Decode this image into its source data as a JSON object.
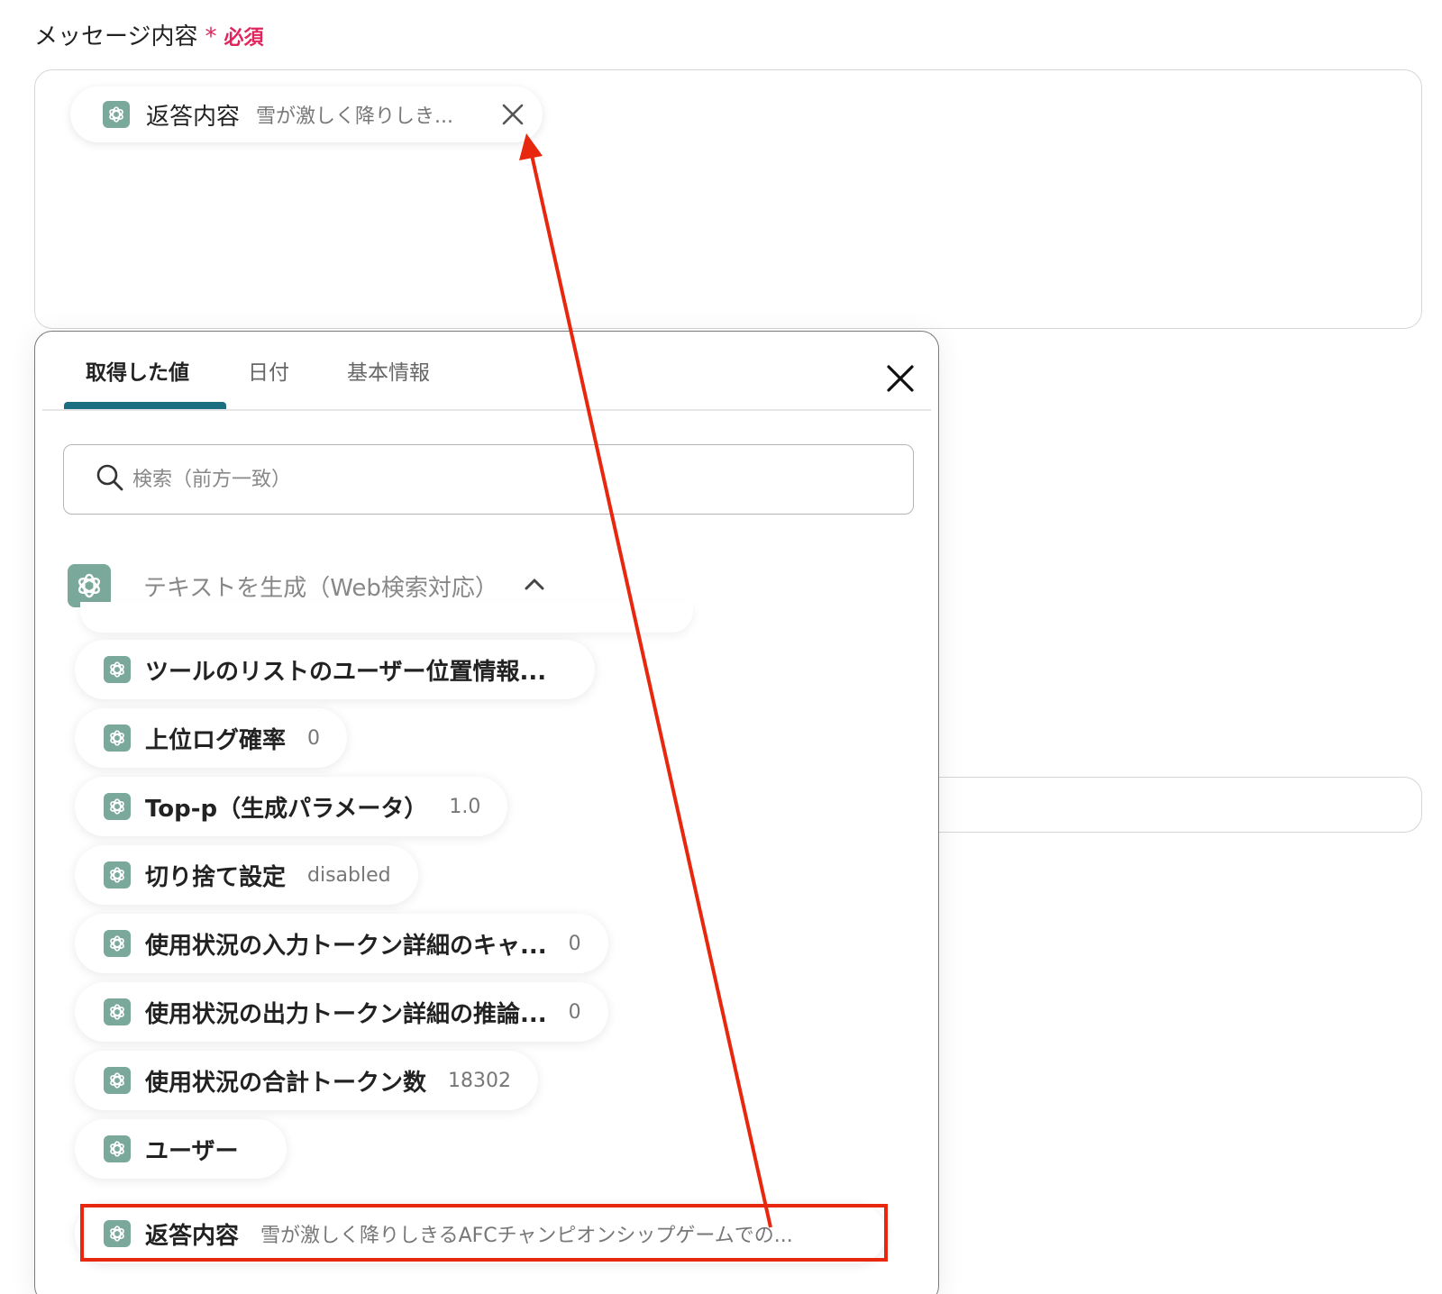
{
  "field": {
    "label": "メッセージ内容",
    "required_mark": "*",
    "required_text": "必須"
  },
  "message_chip": {
    "key": "返答内容",
    "value": "雪が激しく降りしき..."
  },
  "popup": {
    "tabs": [
      {
        "label": "取得した値",
        "active": true
      },
      {
        "label": "日付",
        "active": false
      },
      {
        "label": "基本情報",
        "active": false
      }
    ],
    "search": {
      "placeholder": "検索（前方一致）"
    },
    "section_title": "テキストを生成（Web検索対応）",
    "items": [
      {
        "key": "ツールのリストのユーザー位置情報...",
        "value": ""
      },
      {
        "key": "上位ログ確率",
        "value": "0"
      },
      {
        "key": "Top-p（生成パラメータ）",
        "value": "1.0"
      },
      {
        "key": "切り捨て設定",
        "value": "disabled"
      },
      {
        "key": "使用状況の入力トークン詳細のキャ...",
        "value": "0"
      },
      {
        "key": "使用状況の出力トークン詳細の推論...",
        "value": "0"
      },
      {
        "key": "使用状況の合計トークン数",
        "value": "18302"
      },
      {
        "key": "ユーザー",
        "value": ""
      },
      {
        "key": "返答内容",
        "value": "雪が激しく降りしきるAFCチャンピオンシップゲームでの..."
      }
    ]
  },
  "colors": {
    "accent_tab": "#1b6e80",
    "annotation_red": "#e8280e",
    "required_red": "#e0245e",
    "icon_green": "#7aa89a"
  }
}
